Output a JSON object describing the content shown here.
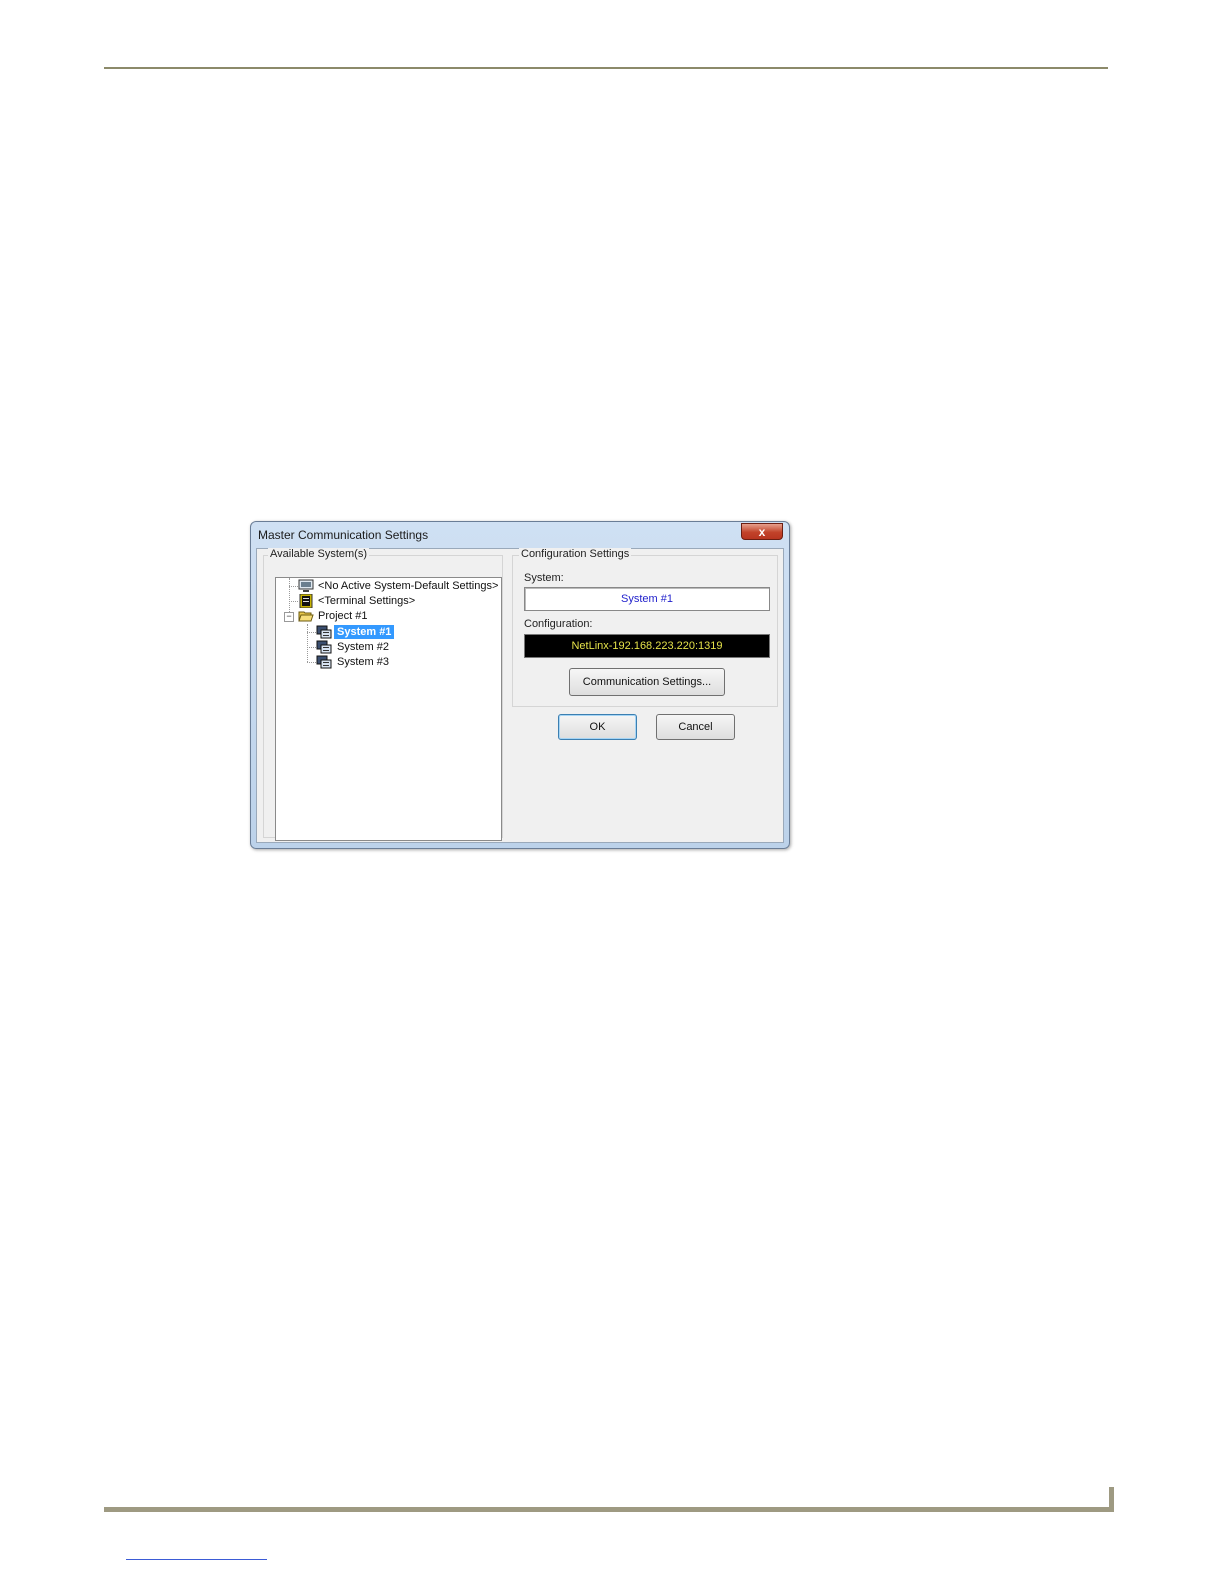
{
  "window": {
    "title": "Master Communication Settings",
    "close_glyph": "x"
  },
  "available": {
    "group_label": "Available System(s)",
    "items": [
      {
        "label": "<No Active System-Default Settings>",
        "icon": "monitor-icon"
      },
      {
        "label": "<Terminal Settings>",
        "icon": "terminal-icon"
      },
      {
        "label": "Project #1",
        "icon": "folder-open-icon",
        "expander": "−"
      },
      {
        "label": "System #1",
        "icon": "system-icon",
        "selected": true
      },
      {
        "label": "System #2",
        "icon": "system-icon"
      },
      {
        "label": "System #3",
        "icon": "system-icon"
      }
    ]
  },
  "config": {
    "group_label": "Configuration Settings",
    "system_label": "System:",
    "system_value": "System #1",
    "configuration_label": "Configuration:",
    "configuration_value": "NetLinx-192.168.223.220:1319",
    "comm_button": "Communication Settings..."
  },
  "buttons": {
    "ok": "OK",
    "cancel": "Cancel"
  },
  "colors": {
    "selection": "#3399ff",
    "config_text": "#e6e34a",
    "system_text": "#2222cc"
  }
}
